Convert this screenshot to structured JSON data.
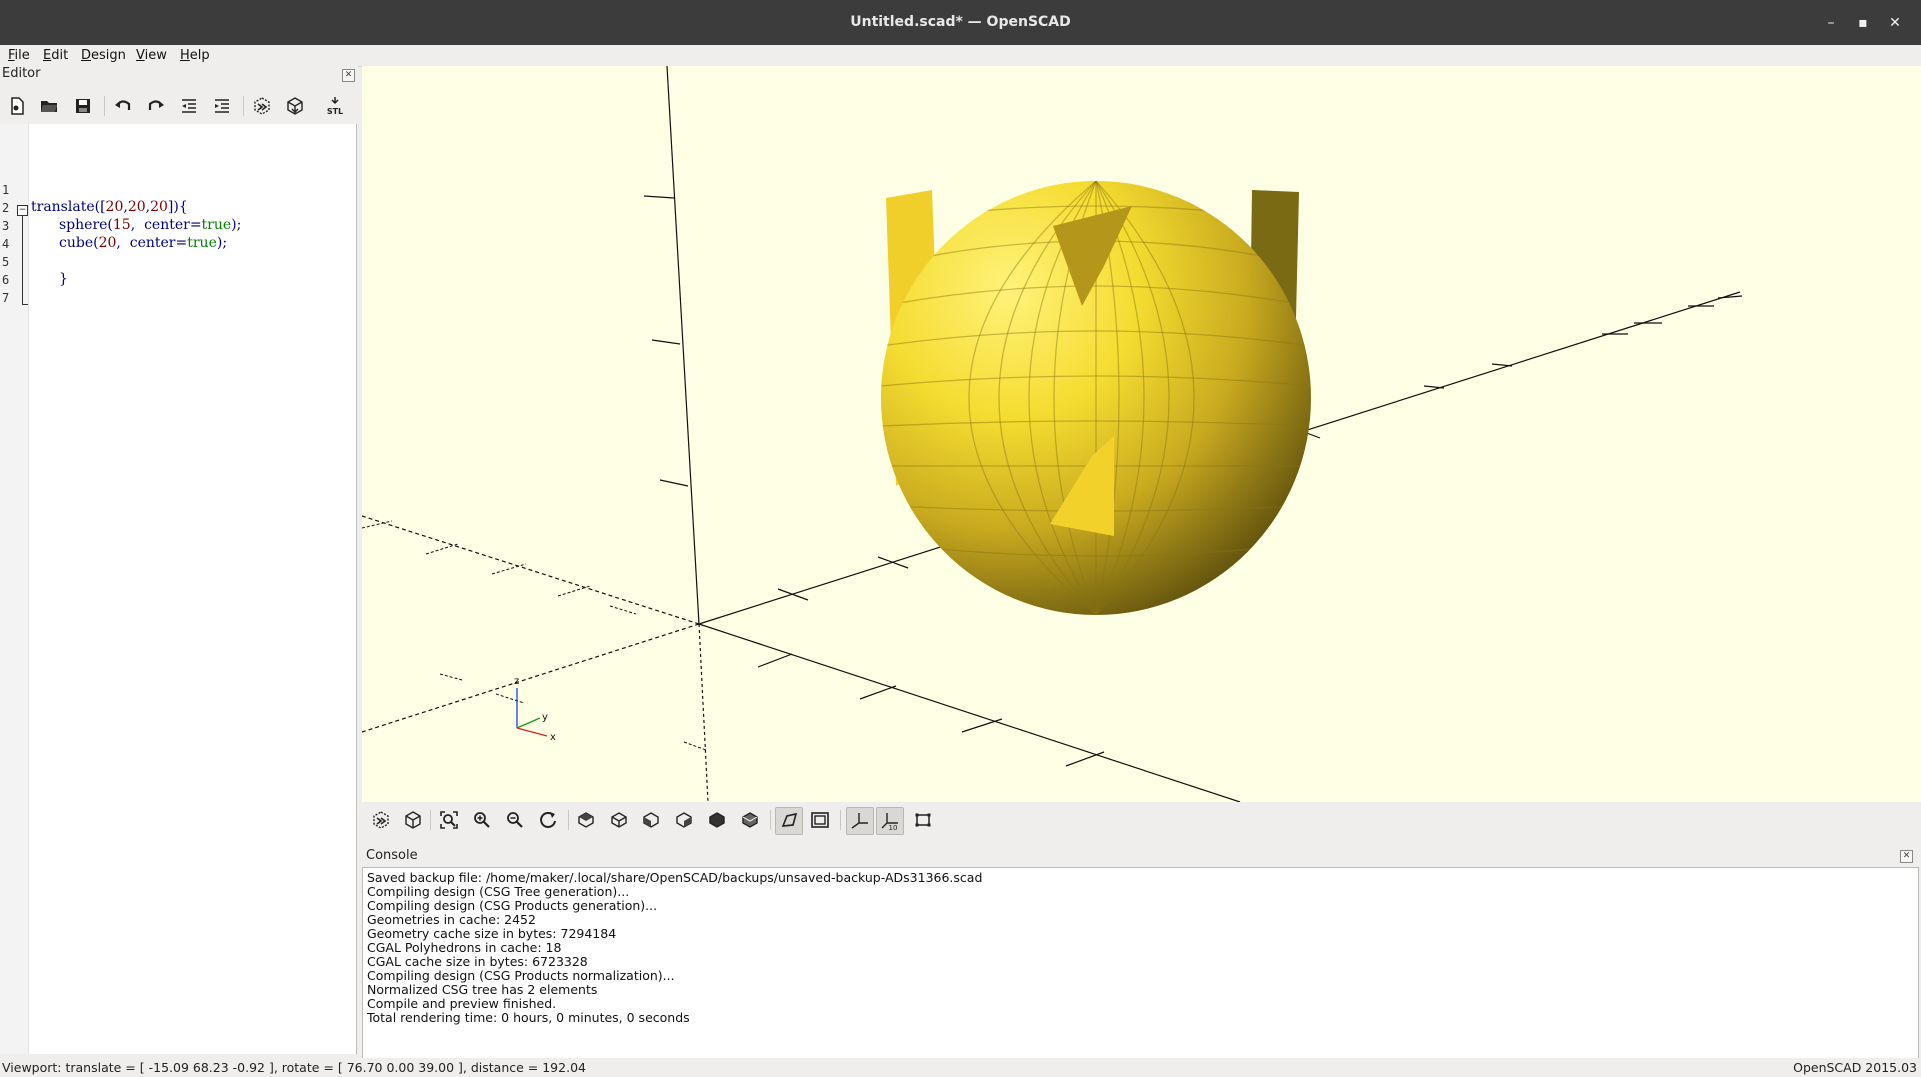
{
  "window": {
    "title": "Untitled.scad* — OpenSCAD",
    "minimize": "–",
    "maximize": "▪",
    "close": "✕"
  },
  "menu": [
    "File",
    "Edit",
    "Design",
    "View",
    "Help"
  ],
  "editor": {
    "header": "Editor",
    "line_numbers": [
      "1",
      "2",
      "3",
      "4",
      "5",
      "6",
      "7"
    ],
    "code": {
      "l2_fn": "translate([",
      "l2_n1": "20",
      "l2_c1": ",",
      "l2_n2": "20",
      "l2_c2": ",",
      "l2_n3": "20",
      "l2_end": "]){",
      "l3_fn": "sphere(",
      "l3_num": "15",
      "l3_mid": ",  center=",
      "l3_kw": "true",
      "l3_end": ");",
      "l4_fn": "cube(",
      "l4_num": "20",
      "l4_mid": ",  center=",
      "l4_kw": "true",
      "l4_end": ");",
      "l6": "}"
    }
  },
  "viewport": {
    "colors": {
      "background": "#ffffe5",
      "model": "#f9d72c"
    },
    "axis_labels": {
      "z": "z",
      "y": "y",
      "x": "x"
    }
  },
  "toolbar_icons": {
    "stl_label": "STL",
    "axes_scale_label": "10"
  },
  "console": {
    "header": "Console",
    "lines": [
      "Saved backup file: /home/maker/.local/share/OpenSCAD/backups/unsaved-backup-ADs31366.scad",
      "Compiling design (CSG Tree generation)...",
      "Compiling design (CSG Products generation)...",
      "Geometries in cache: 2452",
      "Geometry cache size in bytes: 7294184",
      "CGAL Polyhedrons in cache: 18",
      "CGAL cache size in bytes: 6723328",
      "Compiling design (CSG Products normalization)...",
      "Normalized CSG tree has 2 elements",
      "Compile and preview finished.",
      "Total rendering time: 0 hours, 0 minutes, 0 seconds"
    ]
  },
  "status": {
    "viewport": "Viewport: translate = [ -15.09 68.23 -0.92 ], rotate = [ 76.70 0.00 39.00 ], distance = 192.04",
    "version": "OpenSCAD 2015.03"
  }
}
